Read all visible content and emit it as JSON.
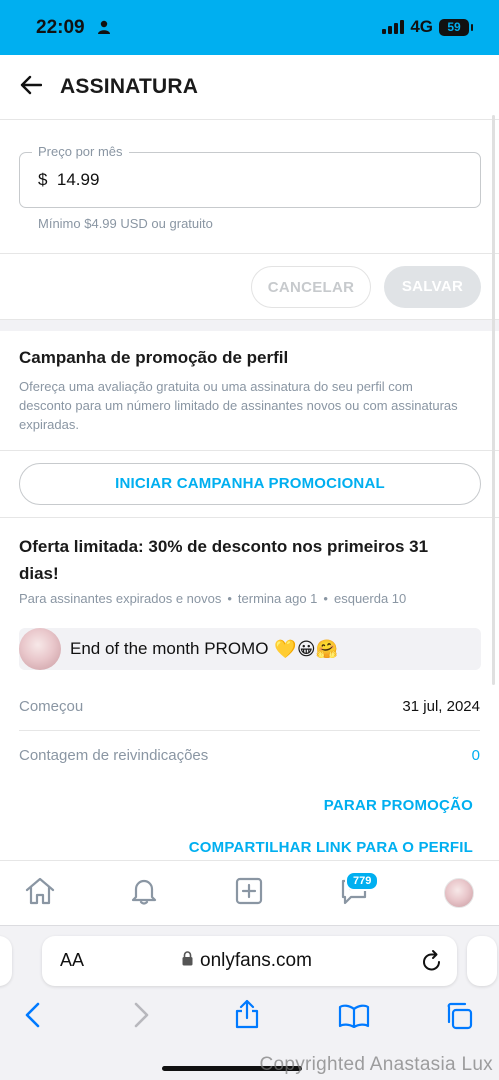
{
  "status_bar": {
    "time": "22:09",
    "network": "4G",
    "battery": "59"
  },
  "header": {
    "title": "ASSINATURA"
  },
  "price": {
    "label": "Preço por mês",
    "value": "$  14.99",
    "hint": "Mínimo $4.99 USD ou gratuito"
  },
  "actions": {
    "cancel_label": "CANCELAR",
    "save_label": "SALVAR"
  },
  "campaign": {
    "title": "Campanha de promoção de perfil",
    "description": "Ofereça uma avaliação gratuita ou uma assinatura do seu perfil com desconto para um número limitado de assinantes novos ou com assinaturas expiradas.",
    "start_button": "INICIAR CAMPANHA PROMOCIONAL"
  },
  "offer": {
    "title": "Oferta limitada: 30% de desconto nos primeiros 31 dias!",
    "audience": "Para assinantes expirados e novos",
    "ends": "termina ago 1",
    "remaining": "esquerda 10",
    "message": "End of the month PROMO",
    "message_emoji": "💛😀🤗",
    "started_label": "Começou",
    "started_value": "31 jul, 2024",
    "claims_label": "Contagem de reivindicações",
    "claims_value": "0",
    "stop_label": "PARAR PROMOÇÃO",
    "share_label": "COMPARTILHAR LINK PARA O PERFIL"
  },
  "tabbar": {
    "messages_badge": "779"
  },
  "browser": {
    "aa": "AA",
    "url": "onlyfans.com"
  },
  "watermark": "Copyrighted Anastasia Lux",
  "colors": {
    "accent": "#00aff0",
    "muted_text": "#8a96a3"
  }
}
